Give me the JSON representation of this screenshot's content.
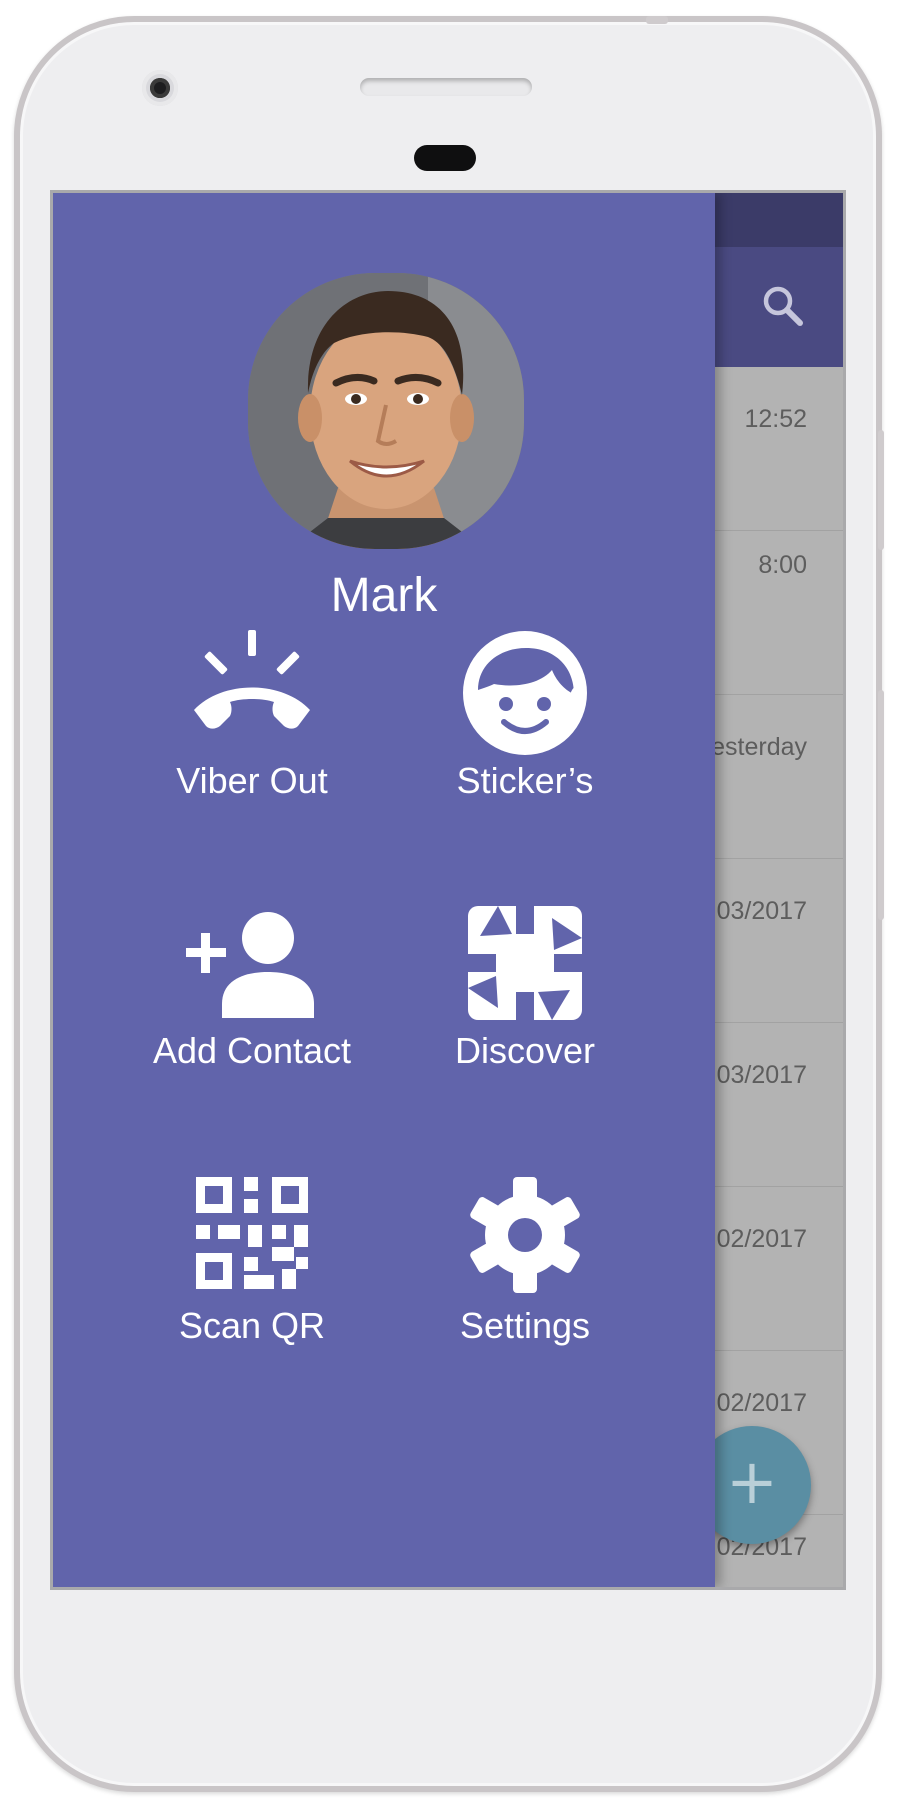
{
  "user": {
    "name": "Mark"
  },
  "menu": [
    {
      "id": "viber-out",
      "label": "Viber Out",
      "icon": "phone-ringing-icon"
    },
    {
      "id": "stickers",
      "label": "Sticker’s",
      "icon": "face-icon"
    },
    {
      "id": "add-contact",
      "label": "Add Contact",
      "icon": "add-person-icon"
    },
    {
      "id": "discover",
      "label": "Discover",
      "icon": "discover-icon"
    },
    {
      "id": "scan-qr",
      "label": "Scan QR",
      "icon": "qr-code-icon"
    },
    {
      "id": "settings",
      "label": "Settings",
      "icon": "gear-icon"
    }
  ],
  "chat_times": [
    "12:52",
    "8:00",
    "esterday",
    "03/2017",
    "03/2017",
    "02/2017",
    "02/2017",
    "02/2017"
  ],
  "colors": {
    "drawer": "#6164ab",
    "toolbar": "#4a4a82",
    "status_bar": "#3b3b68",
    "fab": "#5a8ea3"
  }
}
